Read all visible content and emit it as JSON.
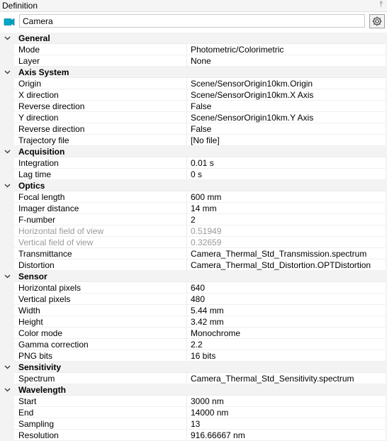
{
  "panel": {
    "title": "Definition",
    "pin_glyph": "⫯",
    "accent": "#00a8c9"
  },
  "name_field": {
    "value": "Camera"
  },
  "icons": {
    "object": "camera-icon",
    "settings": "gear-icon",
    "pin": "pin-icon",
    "expand": "chevron-down-icon"
  },
  "categories": [
    {
      "label": "General",
      "props": [
        {
          "label": "Mode",
          "value": "Photometric/Colorimetric"
        },
        {
          "label": "Layer",
          "value": "None"
        }
      ]
    },
    {
      "label": "Axis System",
      "props": [
        {
          "label": "Origin",
          "value": "Scene/SensorOrigin10km.Origin"
        },
        {
          "label": "X direction",
          "value": "Scene/SensorOrigin10km.X Axis"
        },
        {
          "label": "Reverse direction",
          "value": "False"
        },
        {
          "label": "Y direction",
          "value": "Scene/SensorOrigin10km.Y Axis"
        },
        {
          "label": "Reverse direction",
          "value": "False"
        },
        {
          "label": "Trajectory file",
          "value": "[No file]"
        }
      ]
    },
    {
      "label": "Acquisition",
      "props": [
        {
          "label": "Integration",
          "value": "0.01 s"
        },
        {
          "label": "Lag time",
          "value": "0 s"
        }
      ]
    },
    {
      "label": "Optics",
      "props": [
        {
          "label": "Focal length",
          "value": "600 mm"
        },
        {
          "label": "Imager distance",
          "value": "14 mm"
        },
        {
          "label": "F-number",
          "value": "2"
        },
        {
          "label": "Horizontal field of view",
          "value": "0.51949",
          "readonly": true
        },
        {
          "label": "Vertical field of view",
          "value": "0.32659",
          "readonly": true
        },
        {
          "label": "Transmittance",
          "value": "Camera_Thermal_Std_Transmission.spectrum"
        },
        {
          "label": "Distortion",
          "value": "Camera_Thermal_Std_Distortion.OPTDistortion"
        }
      ]
    },
    {
      "label": "Sensor",
      "props": [
        {
          "label": "Horizontal pixels",
          "value": "640"
        },
        {
          "label": "Vertical pixels",
          "value": "480"
        },
        {
          "label": "Width",
          "value": "5.44 mm"
        },
        {
          "label": "Height",
          "value": "3.42 mm"
        },
        {
          "label": "Color mode",
          "value": "Monochrome"
        },
        {
          "label": "Gamma correction",
          "value": "2.2"
        },
        {
          "label": "PNG bits",
          "value": "16 bits"
        }
      ]
    },
    {
      "label": "Sensitivity",
      "props": [
        {
          "label": "Spectrum",
          "value": "Camera_Thermal_Std_Sensitivity.spectrum"
        }
      ]
    },
    {
      "label": "Wavelength",
      "props": [
        {
          "label": "Start",
          "value": "3000 nm"
        },
        {
          "label": "End",
          "value": "14000 nm"
        },
        {
          "label": "Sampling",
          "value": "13"
        },
        {
          "label": "Resolution",
          "value": "916.66667 nm"
        }
      ]
    }
  ]
}
